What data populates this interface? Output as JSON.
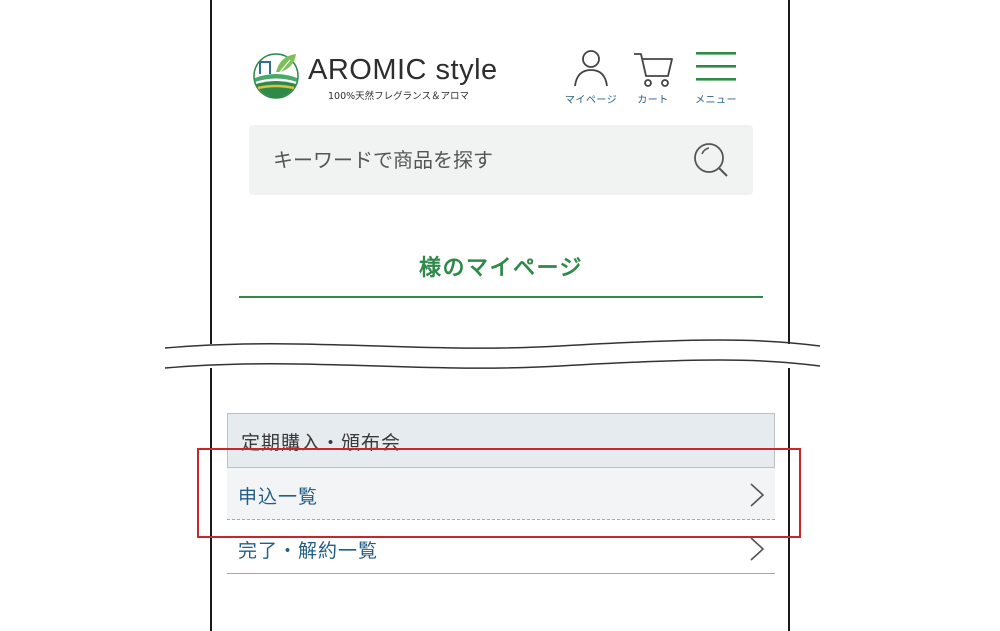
{
  "header": {
    "logo_text": "AROMIC style",
    "logo_tagline": "100%天然フレグランス＆アロマ",
    "mypage_label": "マイページ",
    "cart_label": "カート",
    "menu_label": "メニュー"
  },
  "search": {
    "placeholder": "キーワードで商品を探す"
  },
  "mypage": {
    "title": "様のマイページ"
  },
  "subscription": {
    "heading": "定期購入・頒布会",
    "items": [
      {
        "label": "申込一覧",
        "icon": "chevron-right-icon"
      },
      {
        "label": "完了・解約一覧",
        "icon": "chevron-right-icon"
      }
    ]
  },
  "colors": {
    "accent_green": "#2f8a4a",
    "link_blue": "#245e86",
    "highlight_red": "#c8262b",
    "section_bg": "#e6ebef"
  }
}
